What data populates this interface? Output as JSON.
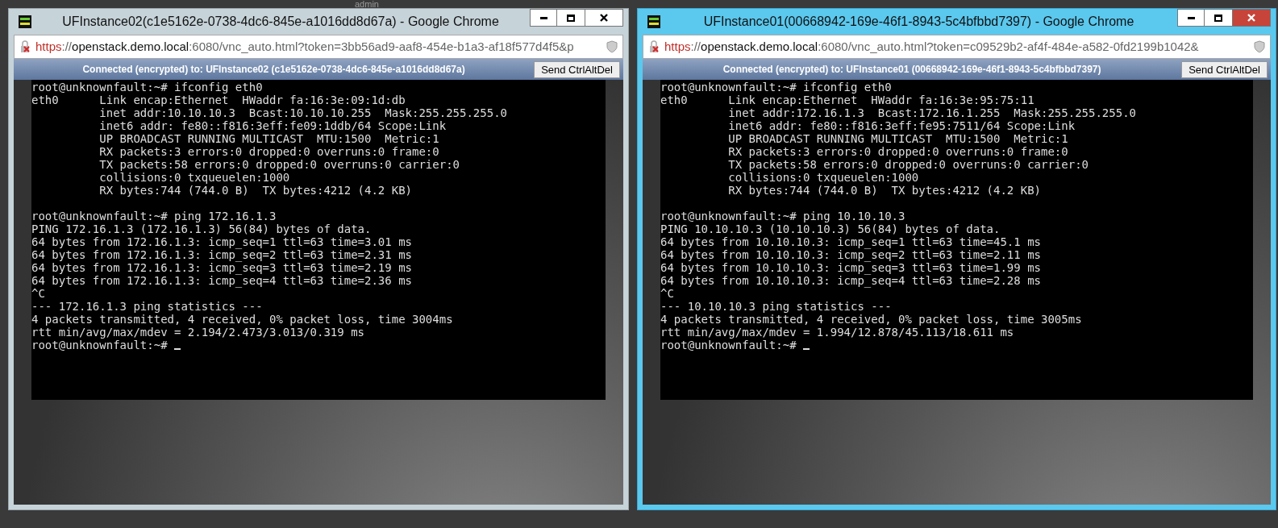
{
  "background": {
    "username": "admin"
  },
  "windows": [
    {
      "focused": false,
      "title": "UFInstance02(c1e5162e-0738-4dc6-845e-a1016dd8d67a) - Google Chrome",
      "url": {
        "scheme": "https",
        "separator": "://",
        "host": "openstack.demo.local",
        "rest": ":6080/vnc_auto.html?token=3bb56ad9-aaf8-454e-b1a3-af18f577d4f5&p"
      },
      "status": "Connected (encrypted) to: UFInstance02 (c1e5162e-0738-4dc6-845e-a1016dd8d67a)",
      "button": "Send CtrlAltDel",
      "terminal": [
        [
          "root@unknownfault:~# ifconfig eth0",
          "eth0      Link encap:Ethernet  HWaddr fa:16:3e:09:1d:db",
          "          inet addr:10.10.10.3  Bcast:10.10.10.255  Mask:255.255.255.0",
          "          inet6 addr: fe80::f816:3eff:fe09:1ddb/64 Scope:Link",
          "          UP BROADCAST RUNNING MULTICAST  MTU:1500  Metric:1",
          "          RX packets:3 errors:0 dropped:0 overruns:0 frame:0",
          "          TX packets:58 errors:0 dropped:0 overruns:0 carrier:0",
          "          collisions:0 txqueuelen:1000",
          "          RX bytes:744 (744.0 B)  TX bytes:4212 (4.2 KB)"
        ],
        [
          "root@unknownfault:~# ping 172.16.1.3",
          "PING 172.16.1.3 (172.16.1.3) 56(84) bytes of data.",
          "64 bytes from 172.16.1.3: icmp_seq=1 ttl=63 time=3.01 ms",
          "64 bytes from 172.16.1.3: icmp_seq=2 ttl=63 time=2.31 ms",
          "64 bytes from 172.16.1.3: icmp_seq=3 ttl=63 time=2.19 ms",
          "64 bytes from 172.16.1.3: icmp_seq=4 ttl=63 time=2.36 ms",
          "^C",
          "--- 172.16.1.3 ping statistics ---",
          "4 packets transmitted, 4 received, 0% packet loss, time 3004ms",
          "rtt min/avg/max/mdev = 2.194/2.473/3.013/0.319 ms",
          "root@unknownfault:~# "
        ]
      ]
    },
    {
      "focused": true,
      "title": "UFInstance01(00668942-169e-46f1-8943-5c4bfbbd7397) - Google Chrome",
      "url": {
        "scheme": "https",
        "separator": "://",
        "host": "openstack.demo.local",
        "rest": ":6080/vnc_auto.html?token=c09529b2-af4f-484e-a582-0fd2199b1042&"
      },
      "status": "Connected (encrypted) to: UFInstance01 (00668942-169e-46f1-8943-5c4bfbbd7397)",
      "button": "Send CtrlAltDel",
      "terminal": [
        [
          "root@unknownfault:~# ifconfig eth0",
          "eth0      Link encap:Ethernet  HWaddr fa:16:3e:95:75:11",
          "          inet addr:172.16.1.3  Bcast:172.16.1.255  Mask:255.255.255.0",
          "          inet6 addr: fe80::f816:3eff:fe95:7511/64 Scope:Link",
          "          UP BROADCAST RUNNING MULTICAST  MTU:1500  Metric:1",
          "          RX packets:3 errors:0 dropped:0 overruns:0 frame:0",
          "          TX packets:58 errors:0 dropped:0 overruns:0 carrier:0",
          "          collisions:0 txqueuelen:1000",
          "          RX bytes:744 (744.0 B)  TX bytes:4212 (4.2 KB)"
        ],
        [
          "root@unknownfault:~# ping 10.10.10.3",
          "PING 10.10.10.3 (10.10.10.3) 56(84) bytes of data.",
          "64 bytes from 10.10.10.3: icmp_seq=1 ttl=63 time=45.1 ms",
          "64 bytes from 10.10.10.3: icmp_seq=2 ttl=63 time=2.11 ms",
          "64 bytes from 10.10.10.3: icmp_seq=3 ttl=63 time=1.99 ms",
          "64 bytes from 10.10.10.3: icmp_seq=4 ttl=63 time=2.28 ms",
          "^C",
          "--- 10.10.10.3 ping statistics ---",
          "4 packets transmitted, 4 received, 0% packet loss, time 3005ms",
          "rtt min/avg/max/mdev = 1.994/12.878/45.113/18.611 ms",
          "root@unknownfault:~# "
        ]
      ]
    }
  ]
}
